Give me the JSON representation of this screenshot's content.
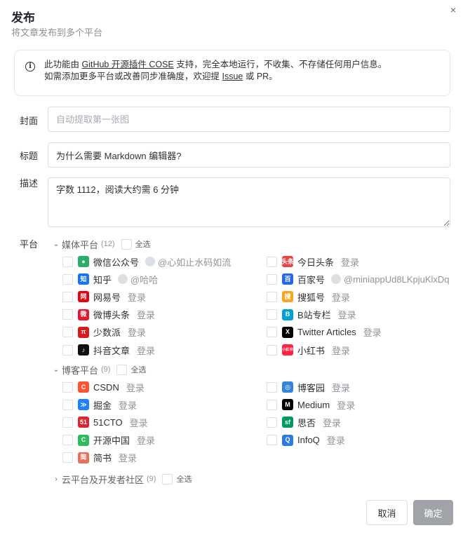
{
  "dialog": {
    "title": "发布",
    "subtitle": "将文章发布到多个平台",
    "close_icon": "×"
  },
  "notice": {
    "line1_prefix": "此功能由 ",
    "line1_link": "GitHub 开源插件 COSE",
    "line1_suffix": " 支持，完全本地运行，不收集、不存储任何用户信息。",
    "line2_prefix": "如需添加更多平台或改善同步准确度，欢迎提 ",
    "line2_link": "Issue",
    "line2_suffix": " 或 PR。"
  },
  "form": {
    "cover_label": "封面",
    "cover_placeholder": "自动提取第一张图",
    "title_label": "标题",
    "title_value": "为什么需要 Markdown 编辑器?",
    "desc_label": "描述",
    "desc_value": "字数 1112，阅读大约需 6 分钟",
    "platform_label": "平台"
  },
  "groups": {
    "media": {
      "chevron": "⌄",
      "name": "媒体平台",
      "count": "(12)",
      "select_all": "全选"
    },
    "blog": {
      "chevron": "⌄",
      "name": "博客平台",
      "count": "(9)",
      "select_all": "全选"
    },
    "cloud": {
      "chevron": "›",
      "name": "云平台及开发者社区",
      "count": "(9)",
      "select_all": "全选"
    }
  },
  "media_platforms": [
    {
      "name": "微信公众号",
      "account": "@心如止水码如流",
      "icon": "wechat-icon",
      "glyph": "●",
      "color": "#2aae67"
    },
    {
      "name": "今日头条",
      "login": "登录",
      "icon": "toutiao-icon",
      "glyph": "头条",
      "color": "#f04142"
    },
    {
      "name": "知乎",
      "account": "@哈哈",
      "icon": "zhihu-icon",
      "glyph": "知",
      "color": "#1772f6"
    },
    {
      "name": "百家号",
      "account": "@miniappUd8LKpjuKlxDq",
      "icon": "baijiahao-icon",
      "glyph": "百",
      "color": "#2468f2"
    },
    {
      "name": "网易号",
      "login": "登录",
      "icon": "netease-icon",
      "glyph": "网",
      "color": "#e60012"
    },
    {
      "name": "搜狐号",
      "login": "登录",
      "icon": "sohu-icon",
      "glyph": "搜",
      "color": "#f5a623"
    },
    {
      "name": "微博头条",
      "login": "登录",
      "icon": "weibo-icon",
      "glyph": "微",
      "color": "#e6162d"
    },
    {
      "name": "B站专栏",
      "login": "登录",
      "icon": "bilibili-icon",
      "glyph": "B",
      "color": "#00a1d6"
    },
    {
      "name": "少数派",
      "login": "登录",
      "icon": "sspai-icon",
      "glyph": "π",
      "color": "#d71a1b"
    },
    {
      "name": "Twitter Articles",
      "login": "登录",
      "icon": "x-twitter-icon",
      "glyph": "X",
      "color": "#000000"
    },
    {
      "name": "抖音文章",
      "login": "登录",
      "icon": "douyin-icon",
      "glyph": "♪",
      "color": "#111111"
    },
    {
      "name": "小红书",
      "login": "登录",
      "icon": "xiaohongshu-icon",
      "glyph": "小红书",
      "color": "#ff2442"
    }
  ],
  "blog_platforms": [
    {
      "name": "CSDN",
      "login": "登录",
      "icon": "csdn-icon",
      "glyph": "C",
      "color": "#fc5531"
    },
    {
      "name": "博客园",
      "login": "登录",
      "icon": "cnblogs-icon",
      "glyph": "◎",
      "color": "#3385d8"
    },
    {
      "name": "掘金",
      "login": "登录",
      "icon": "juejin-icon",
      "glyph": "≫",
      "color": "#1e80ff"
    },
    {
      "name": "Medium",
      "login": "登录",
      "icon": "medium-icon",
      "glyph": "M",
      "color": "#000000"
    },
    {
      "name": "51CTO",
      "login": "登录",
      "icon": "51cto-icon",
      "glyph": "51",
      "color": "#d9282f"
    },
    {
      "name": "思否",
      "login": "登录",
      "icon": "segmentfault-icon",
      "glyph": "sf",
      "color": "#009a61"
    },
    {
      "name": "开源中国",
      "login": "登录",
      "icon": "oschina-icon",
      "glyph": "C",
      "color": "#2bbc5d"
    },
    {
      "name": "InfoQ",
      "login": "登录",
      "icon": "infoq-icon",
      "glyph": "Q",
      "color": "#2c7be5"
    },
    {
      "name": "简书",
      "login": "登录",
      "icon": "jianshu-icon",
      "glyph": "简",
      "color": "#ea6f5a"
    }
  ],
  "buttons": {
    "cancel": "取消",
    "confirm": "确定"
  }
}
